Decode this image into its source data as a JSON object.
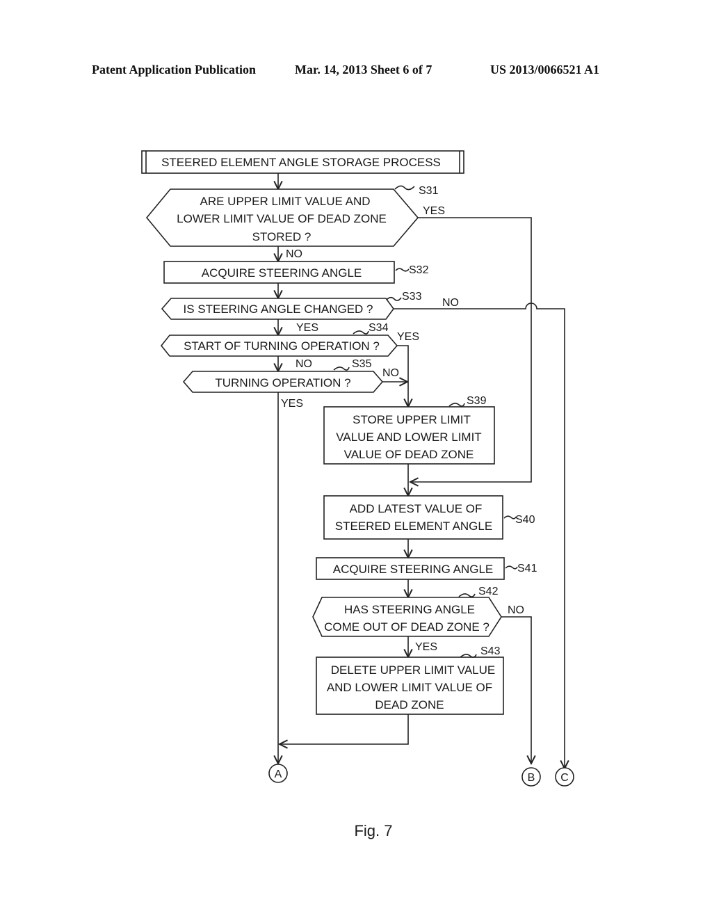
{
  "header": {
    "left": "Patent Application Publication",
    "middle": "Mar. 14, 2013  Sheet 6 of 7",
    "right": "US 2013/0066521 A1"
  },
  "flowchart": {
    "start": "STEERED ELEMENT ANGLE STORAGE PROCESS",
    "s31": {
      "id": "S31",
      "lines": [
        "ARE UPPER LIMIT VALUE AND",
        "LOWER LIMIT VALUE OF DEAD ZONE",
        "STORED ?"
      ],
      "yes": "YES",
      "no": "NO"
    },
    "s32": {
      "id": "S32",
      "lines": [
        "ACQUIRE STEERING ANGLE"
      ]
    },
    "s33": {
      "id": "S33",
      "lines": [
        "IS STEERING ANGLE CHANGED ?"
      ],
      "yes": "YES",
      "no": "NO"
    },
    "s34": {
      "id": "S34",
      "lines": [
        "START OF TURNING OPERATION ?"
      ],
      "yes": "YES",
      "no": "NO"
    },
    "s35": {
      "id": "S35",
      "lines": [
        "TURNING OPERATION ?"
      ],
      "yes": "YES",
      "no": "NO"
    },
    "s39": {
      "id": "S39",
      "lines": [
        "STORE UPPER LIMIT",
        "VALUE AND LOWER LIMIT",
        "VALUE OF DEAD ZONE"
      ]
    },
    "s40": {
      "id": "S40",
      "lines": [
        "ADD LATEST VALUE OF",
        "STEERED ELEMENT ANGLE"
      ]
    },
    "s41": {
      "id": "S41",
      "lines": [
        "ACQUIRE STEERING ANGLE"
      ]
    },
    "s42": {
      "id": "S42",
      "lines": [
        "HAS STEERING ANGLE",
        "COME OUT OF DEAD ZONE ?"
      ],
      "yes": "YES",
      "no": "NO"
    },
    "s43": {
      "id": "S43",
      "lines": [
        "DELETE UPPER LIMIT VALUE",
        "AND LOWER LIMIT VALUE OF",
        "DEAD ZONE"
      ]
    },
    "connectors": {
      "a": "A",
      "b": "B",
      "c": "C"
    }
  },
  "figure_caption": "Fig. 7"
}
